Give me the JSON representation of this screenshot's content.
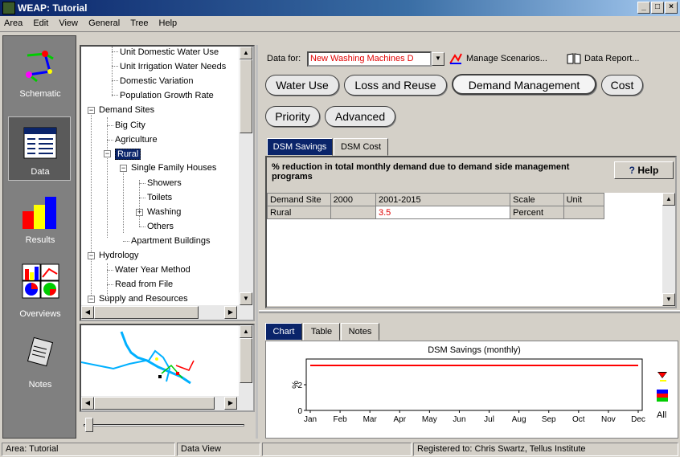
{
  "window": {
    "title": "WEAP: Tutorial"
  },
  "menu": [
    "Area",
    "Edit",
    "View",
    "General",
    "Tree",
    "Help"
  ],
  "nav": [
    {
      "label": "Schematic"
    },
    {
      "label": "Data"
    },
    {
      "label": "Results"
    },
    {
      "label": "Overviews"
    },
    {
      "label": "Notes"
    }
  ],
  "tree": {
    "items": [
      "Unit Domestic Water Use",
      "Unit Irrigation Water Needs",
      "Domestic Variation",
      "Population Growth Rate",
      "Demand Sites",
      "Big City",
      "Agriculture",
      "Rural",
      "Single Family Houses",
      "Showers",
      "Toilets",
      "Washing",
      "Others",
      "Apartment Buildings",
      "Hydrology",
      "Water Year Method",
      "Read from File",
      "Supply and Resources"
    ]
  },
  "datafor": {
    "label": "Data for:",
    "value": "New Washing Machines D"
  },
  "toolbar": {
    "manage_scenarios": "Manage Scenarios...",
    "data_report": "Data Report..."
  },
  "categories": [
    "Water Use",
    "Loss and Reuse",
    "Demand Management",
    "Cost",
    "Priority",
    "Advanced"
  ],
  "tabs": [
    "DSM Savings",
    "DSM Cost"
  ],
  "description": "% reduction in total monthly demand due to demand side management programs",
  "help_label": "Help",
  "table": {
    "headers": [
      "Demand Site",
      "2000",
      "2001-2015",
      "Scale",
      "Unit"
    ],
    "rows": [
      [
        "Rural",
        "",
        "3.5",
        "Percent",
        ""
      ]
    ]
  },
  "bottom_tabs": [
    "Chart",
    "Table",
    "Notes"
  ],
  "chart_data": {
    "type": "line",
    "title": "DSM Savings (monthly)",
    "ylabel": "%",
    "categories": [
      "Jan",
      "Feb",
      "Mar",
      "Apr",
      "May",
      "Jun",
      "Jul",
      "Aug",
      "Sep",
      "Oct",
      "Nov",
      "Dec"
    ],
    "series": [
      {
        "values": [
          3.5,
          3.5,
          3.5,
          3.5,
          3.5,
          3.5,
          3.5,
          3.5,
          3.5,
          3.5,
          3.5,
          3.5
        ],
        "color": "#ff0000"
      }
    ],
    "yticks": [
      0,
      2
    ],
    "ylim": [
      0,
      4
    ]
  },
  "chart_side": {
    "all_label": "All"
  },
  "status": [
    "Area: Tutorial",
    "Data View",
    "",
    "Registered to: Chris Swartz, Tellus Institute"
  ]
}
